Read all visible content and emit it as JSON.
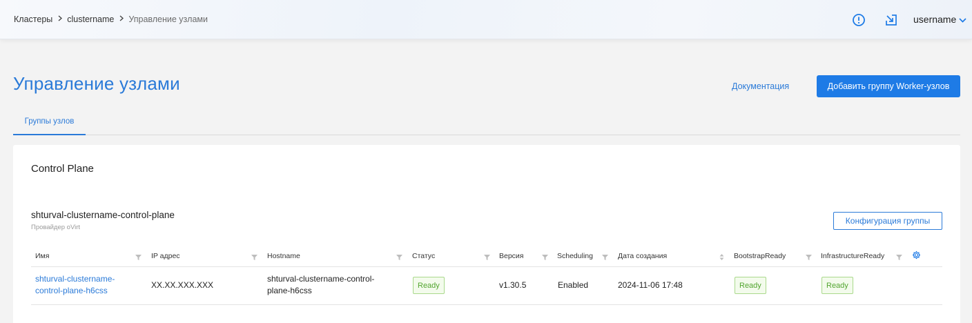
{
  "header": {
    "breadcrumb": [
      "Кластеры",
      "clustername",
      "Управление узлами"
    ],
    "username": "username",
    "icons": {
      "alert": "alert-circle-icon",
      "export": "external-arrow-icon",
      "chevron": "chevron-down-icon"
    }
  },
  "page": {
    "title": "Управление узлами",
    "docs_link": "Документация",
    "add_group_button": "Добавить группу Worker-узлов",
    "tabs": [
      {
        "label": "Группы узлов",
        "active": true
      }
    ]
  },
  "control_plane": {
    "section_title": "Control Plane",
    "group_name": "shturval-clustername-control-plane",
    "provider": "Провайдер oVirt",
    "config_button": "Конфигурация группы",
    "columns": [
      "Имя",
      "IP адрес",
      "Hostname",
      "Статус",
      "Версия",
      "Scheduling",
      "Дата создания",
      "BootstrapReady",
      "InfrastructureReady"
    ],
    "rows": [
      {
        "name_line1": "shturval-clustername-",
        "name_line2": "control-plane-h6css",
        "ip": "XX.XX.XXX.XXX",
        "hostname_line1": "shturval-clustername-control-",
        "hostname_line2": "plane-h6css",
        "status": "Ready",
        "version": "v1.30.5",
        "scheduling": "Enabled",
        "created": "2024-11-06 17:48",
        "bootstrap_ready": "Ready",
        "infrastructure_ready": "Ready"
      }
    ]
  },
  "colors": {
    "accent": "#1e7be6",
    "link": "#2a7ad8",
    "ready_text": "#52a52f",
    "ready_border": "#a9d98b"
  }
}
